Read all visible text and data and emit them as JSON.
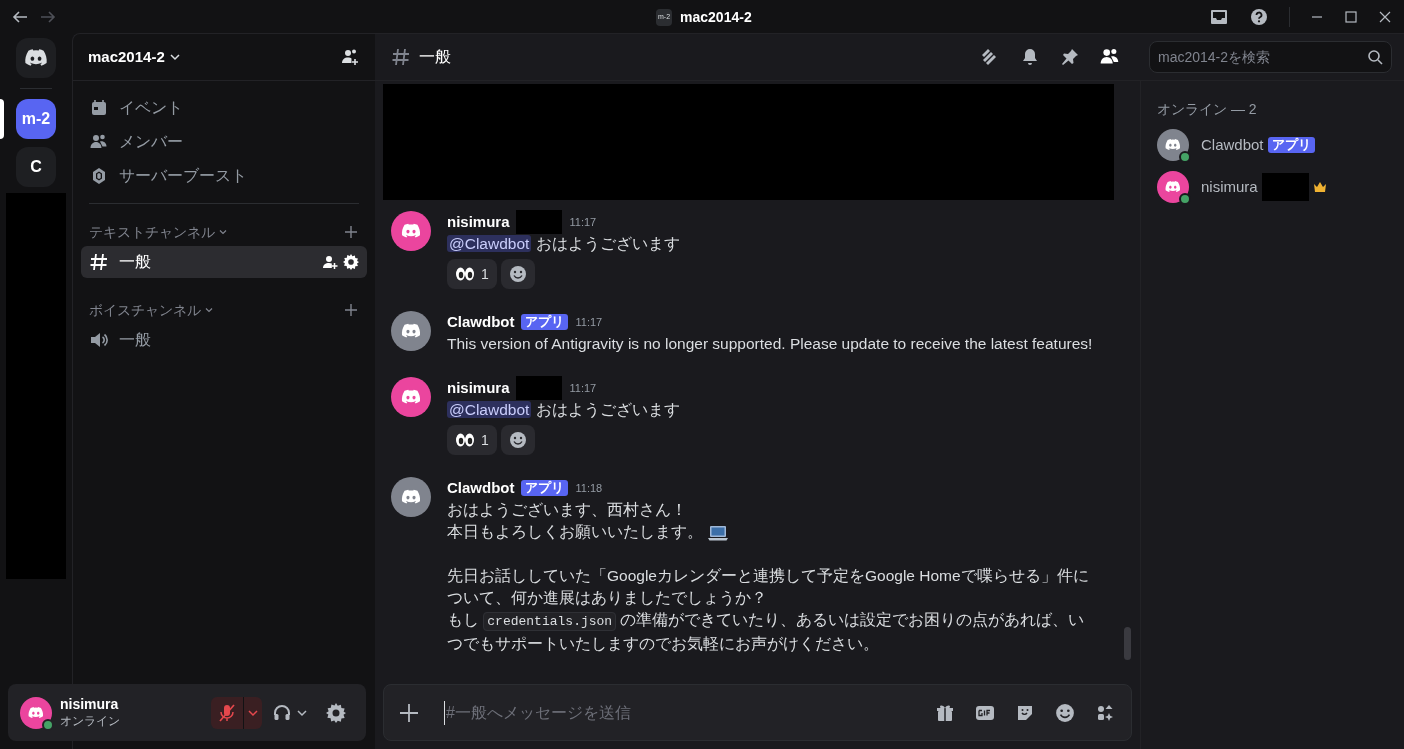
{
  "window": {
    "title": "mac2014-2",
    "server_badge": "m-2"
  },
  "servers": [
    {
      "label": "m-2",
      "selected": true
    },
    {
      "label": "C",
      "selected": false
    }
  ],
  "server_header": {
    "name": "mac2014-2"
  },
  "nav_items": [
    {
      "kind": "event",
      "label": "イベント"
    },
    {
      "kind": "members",
      "label": "メンバー"
    },
    {
      "kind": "boost",
      "label": "サーバーブースト"
    }
  ],
  "categories": [
    {
      "title": "テキストチャンネル",
      "channels": [
        {
          "kind": "text",
          "name": "一般",
          "selected": true
        }
      ]
    },
    {
      "title": "ボイスチャンネル",
      "channels": [
        {
          "kind": "voice",
          "name": "一般",
          "selected": false
        }
      ]
    }
  ],
  "user_panel": {
    "name": "nisimura",
    "status": "オンライン",
    "muted": true
  },
  "channel_header": {
    "name": "一般",
    "search_placeholder": "mac2014-2を検索"
  },
  "messages": [
    {
      "author": "nisimura",
      "redacted": true,
      "time": "11:17",
      "color": "#eb459e",
      "paragraphs": [
        [
          [
            {
              "kind": "mention",
              "text": "@Clawdbot"
            },
            {
              "kind": "text",
              "text": " おはようございます"
            }
          ]
        ]
      ],
      "reactions": [
        {
          "count": "1"
        }
      ]
    },
    {
      "author": "Clawdbot",
      "redacted": false,
      "badge": "アプリ",
      "time": "11:17",
      "color": "#80848e",
      "paragraphs": [
        [
          [
            {
              "kind": "text",
              "text": "This version of Antigravity is no longer supported. Please update to receive the latest features!"
            }
          ]
        ]
      ]
    },
    {
      "author": "nisimura",
      "redacted": true,
      "time": "11:17",
      "color": "#eb459e",
      "paragraphs": [
        [
          [
            {
              "kind": "mention",
              "text": "@Clawdbot"
            },
            {
              "kind": "text",
              "text": " おはようございます"
            }
          ]
        ]
      ],
      "reactions": [
        {
          "count": "1"
        }
      ]
    },
    {
      "author": "Clawdbot",
      "redacted": false,
      "badge": "アプリ",
      "time": "11:18",
      "color": "#80848e",
      "paragraphs": [
        [
          [
            {
              "kind": "text",
              "text": "おはようございます、西村さん！"
            }
          ],
          [
            {
              "kind": "text",
              "text": "本日もよろしくお願いいたします。"
            },
            {
              "kind": "laptop"
            }
          ]
        ],
        [
          [
            {
              "kind": "text",
              "text": "先日お話ししていた「Googleカレンダーと連携して予定をGoogle Homeで喋らせる」件について、何か進展はありましたでしょうか？"
            }
          ],
          [
            {
              "kind": "text",
              "text": "もし "
            },
            {
              "kind": "code",
              "text": "credentials.json"
            },
            {
              "kind": "text",
              "text": " の準備ができていたり、あるいは設定でお困りの点があれば、いつでもサポートいたしますのでお気軽にお声がけください。"
            }
          ]
        ]
      ]
    }
  ],
  "composer": {
    "placeholder": "#一般へメッセージを送信"
  },
  "members": {
    "heading": "オンライン — 2",
    "list": [
      {
        "name": "Clawdbot",
        "badge": "アプリ",
        "owner": false,
        "redacted": false,
        "color": "#80848e"
      },
      {
        "name": "nisimura",
        "owner": true,
        "redacted": true,
        "color": "#eb459e"
      }
    ]
  }
}
